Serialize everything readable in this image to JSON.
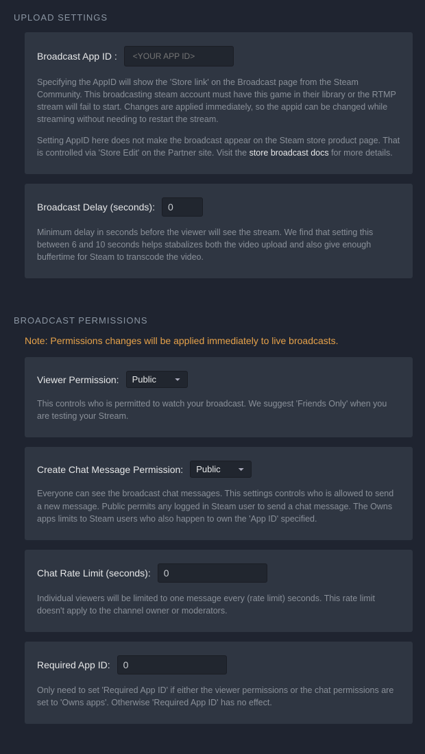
{
  "upload": {
    "title": "UPLOAD SETTINGS",
    "appid": {
      "label": "Broadcast App ID :",
      "placeholder": "<YOUR APP ID>",
      "desc1": "Specifying the AppID will show the 'Store link' on the Broadcast page from the Steam Community. This broadcasting steam account must have this game in their library or the RTMP stream will fail to start. Changes are applied immediately, so the appid can be changed while streaming without needing to restart the stream.",
      "desc2_pre": " Setting AppID here does not make the broadcast appear on the Steam store product page. That is controlled via 'Store Edit' on the Partner site. Visit the ",
      "desc2_link": "store broadcast docs",
      "desc2_post": " for more details."
    },
    "delay": {
      "label": "Broadcast Delay (seconds):",
      "value": "0",
      "desc": "Minimum delay in seconds before the viewer will see the stream. We find that setting this between 6 and 10 seconds helps stabalizes both the video upload and also give enough buffertime for Steam to transcode the video."
    }
  },
  "perms": {
    "title": "BROADCAST PERMISSIONS",
    "note": "Note: Permissions changes will be applied immediately to live broadcasts.",
    "viewer": {
      "label": "Viewer Permission:",
      "value": "Public",
      "desc": "This controls who is permitted to watch your broadcast. We suggest 'Friends Only' when you are testing your Stream."
    },
    "chat": {
      "label": "Create Chat Message Permission:",
      "value": "Public",
      "desc": "Everyone can see the broadcast chat messages. This settings controls who is allowed to send a new message. Public permits any logged in Steam user to send a chat message. The Owns apps limits to Steam users who also happen to own the 'App ID' specified."
    },
    "rate": {
      "label": "Chat Rate Limit (seconds):",
      "value": "0",
      "desc": "Individual viewers will be limited to one message every (rate limit) seconds. This rate limit doesn't apply to the channel owner or moderators."
    },
    "reqapp": {
      "label": "Required App ID:",
      "value": "0",
      "desc": "Only need to set 'Required App ID' if either the viewer permissions or the chat permissions are set to 'Owns apps'. Otherwise 'Required App ID' has no effect."
    }
  }
}
